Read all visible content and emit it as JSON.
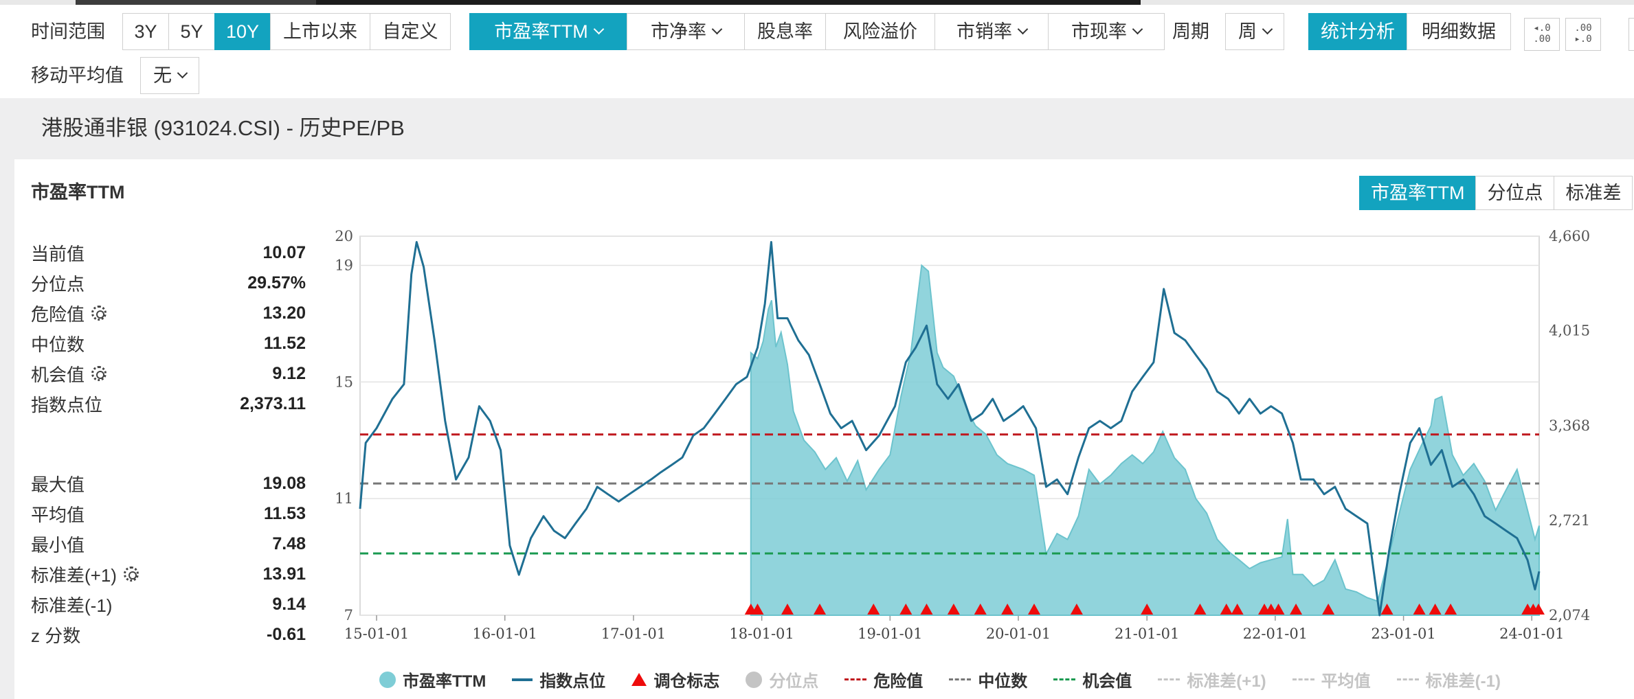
{
  "toolbar": {
    "time_range_label": "时间范围",
    "time_ranges": [
      "3Y",
      "5Y",
      "10Y",
      "上市以来",
      "自定义"
    ],
    "time_range_selected": "10Y",
    "metrics": [
      "市盈率TTM",
      "市净率",
      "股息率",
      "风险溢价",
      "市销率",
      "市现率"
    ],
    "metric_selected": "市盈率TTM",
    "period_label": "周期",
    "period_value": "周",
    "views": [
      "统计分析",
      "明细数据"
    ],
    "view_selected": "统计分析",
    "decimal_inc_icon": "increase-decimals-icon",
    "decimal_dec_icon": "decrease-decimals-icon",
    "ma_label": "移动平均值",
    "ma_value": "无"
  },
  "page_title": "港股通非银 (931024.CSI) - 历史PE/PB",
  "card": {
    "title": "市盈率TTM",
    "tabs": [
      "市盈率TTM",
      "分位点",
      "标准差"
    ],
    "tab_selected": "市盈率TTM"
  },
  "stats_top": [
    {
      "label": "当前值",
      "value": "10.07",
      "gear": false
    },
    {
      "label": "分位点",
      "value": "29.57%",
      "gear": false
    },
    {
      "label": "危险值",
      "value": "13.20",
      "gear": true
    },
    {
      "label": "中位数",
      "value": "11.52",
      "gear": false
    },
    {
      "label": "机会值",
      "value": "9.12",
      "gear": true
    },
    {
      "label": "指数点位",
      "value": "2,373.11",
      "gear": false
    }
  ],
  "stats_bottom": [
    {
      "label": "最大值",
      "value": "19.08",
      "gear": false
    },
    {
      "label": "平均值",
      "value": "11.53",
      "gear": false
    },
    {
      "label": "最小值",
      "value": "7.48",
      "gear": false
    },
    {
      "label": "标准差(+1)",
      "value": "13.91",
      "gear": true
    },
    {
      "label": "标准差(-1)",
      "value": "9.14",
      "gear": false
    },
    {
      "label": "z 分数",
      "value": "-0.61",
      "gear": false
    }
  ],
  "colors": {
    "accent": "#13a3bf",
    "pe_area": "#7ecdd6",
    "index_line": "#1f6f93",
    "danger": "#c0181e",
    "median": "#777777",
    "opportunity": "#1a9a50",
    "marker": "#ee0b0b"
  },
  "chart_data": {
    "type": "area",
    "x_ticks": [
      "15-01-01",
      "16-01-01",
      "17-01-01",
      "18-01-01",
      "19-01-01",
      "20-01-01",
      "21-01-01",
      "22-01-01",
      "23-01-01",
      "24-01-01"
    ],
    "y_left_ticks": [
      "20",
      "19",
      "15",
      "11",
      "7"
    ],
    "y_left_range": [
      7,
      20
    ],
    "y_right_ticks": [
      "4,660",
      "4,015",
      "3,368",
      "2,721",
      "2,074"
    ],
    "y_right_range": [
      2074,
      4660
    ],
    "x_range": [
      "2014-11-15",
      "2024-01-22"
    ],
    "grid": true,
    "legend_position": "bottom",
    "series": [
      {
        "name": "市盈率TTM",
        "axis": "left",
        "style": "area",
        "points": [
          [
            "2017-12-01",
            16.0
          ],
          [
            "2017-12-20",
            15.8
          ],
          [
            "2018-01-05",
            16.4
          ],
          [
            "2018-01-20",
            17.5
          ],
          [
            "2018-01-29",
            17.8
          ],
          [
            "2018-02-10",
            16.2
          ],
          [
            "2018-02-25",
            16.7
          ],
          [
            "2018-03-15",
            15.6
          ],
          [
            "2018-04-01",
            14.0
          ],
          [
            "2018-05-01",
            13.0
          ],
          [
            "2018-06-01",
            12.6
          ],
          [
            "2018-07-01",
            12.0
          ],
          [
            "2018-08-01",
            12.4
          ],
          [
            "2018-09-01",
            11.6
          ],
          [
            "2018-10-01",
            12.3
          ],
          [
            "2018-10-25",
            11.3
          ],
          [
            "2018-12-01",
            12.0
          ],
          [
            "2019-01-01",
            12.5
          ],
          [
            "2019-02-01",
            14.5
          ],
          [
            "2019-03-01",
            16.0
          ],
          [
            "2019-04-01",
            19.0
          ],
          [
            "2019-04-20",
            18.8
          ],
          [
            "2019-05-15",
            16.0
          ],
          [
            "2019-06-01",
            15.5
          ],
          [
            "2019-07-01",
            15.2
          ],
          [
            "2019-08-10",
            14.0
          ],
          [
            "2019-09-01",
            13.5
          ],
          [
            "2019-10-01",
            13.2
          ],
          [
            "2019-11-01",
            12.5
          ],
          [
            "2019-12-01",
            12.2
          ],
          [
            "2020-01-15",
            12.0
          ],
          [
            "2020-02-15",
            11.8
          ],
          [
            "2020-03-20",
            9.1
          ],
          [
            "2020-04-20",
            9.8
          ],
          [
            "2020-05-20",
            9.6
          ],
          [
            "2020-06-20",
            10.4
          ],
          [
            "2020-07-20",
            12.0
          ],
          [
            "2020-08-20",
            11.5
          ],
          [
            "2020-09-20",
            11.8
          ],
          [
            "2020-10-20",
            12.2
          ],
          [
            "2020-11-20",
            12.5
          ],
          [
            "2020-12-20",
            12.2
          ],
          [
            "2021-01-20",
            12.6
          ],
          [
            "2021-02-15",
            13.3
          ],
          [
            "2021-03-20",
            12.4
          ],
          [
            "2021-04-20",
            12.0
          ],
          [
            "2021-05-20",
            11.0
          ],
          [
            "2021-06-20",
            10.5
          ],
          [
            "2021-07-20",
            9.6
          ],
          [
            "2021-08-20",
            9.2
          ],
          [
            "2021-09-20",
            8.9
          ],
          [
            "2021-10-20",
            8.6
          ],
          [
            "2021-11-20",
            8.8
          ],
          [
            "2021-12-20",
            8.9
          ],
          [
            "2022-01-20",
            9.0
          ],
          [
            "2022-02-05",
            10.3
          ],
          [
            "2022-02-20",
            8.4
          ],
          [
            "2022-03-20",
            8.4
          ],
          [
            "2022-04-20",
            8.0
          ],
          [
            "2022-05-20",
            8.2
          ],
          [
            "2022-06-20",
            8.9
          ],
          [
            "2022-07-20",
            7.9
          ],
          [
            "2022-08-20",
            7.8
          ],
          [
            "2022-09-20",
            7.6
          ],
          [
            "2022-10-20",
            7.48
          ],
          [
            "2022-11-20",
            9.0
          ],
          [
            "2022-12-20",
            10.5
          ],
          [
            "2023-01-20",
            12.0
          ],
          [
            "2023-02-20",
            12.8
          ],
          [
            "2023-03-20",
            13.5
          ],
          [
            "2023-04-01",
            14.4
          ],
          [
            "2023-04-20",
            14.5
          ],
          [
            "2023-05-20",
            12.5
          ],
          [
            "2023-06-20",
            11.8
          ],
          [
            "2023-07-20",
            12.2
          ],
          [
            "2023-08-20",
            11.6
          ],
          [
            "2023-09-20",
            10.6
          ],
          [
            "2023-10-20",
            11.3
          ],
          [
            "2023-11-20",
            12.0
          ],
          [
            "2023-12-20",
            10.6
          ],
          [
            "2024-01-10",
            9.6
          ],
          [
            "2024-01-22",
            10.07
          ]
        ]
      },
      {
        "name": "指数点位",
        "axis": "right",
        "style": "line",
        "points": [
          [
            "2014-11-15",
            2800
          ],
          [
            "2014-12-01",
            3250
          ],
          [
            "2015-01-01",
            3350
          ],
          [
            "2015-02-15",
            3550
          ],
          [
            "2015-03-20",
            3650
          ],
          [
            "2015-04-10",
            4400
          ],
          [
            "2015-04-25",
            4620
          ],
          [
            "2015-05-15",
            4450
          ],
          [
            "2015-06-15",
            3950
          ],
          [
            "2015-07-15",
            3400
          ],
          [
            "2015-08-15",
            3000
          ],
          [
            "2015-09-20",
            3150
          ],
          [
            "2015-10-20",
            3500
          ],
          [
            "2015-11-20",
            3400
          ],
          [
            "2015-12-20",
            3200
          ],
          [
            "2016-01-15",
            2550
          ],
          [
            "2016-02-10",
            2350
          ],
          [
            "2016-03-15",
            2600
          ],
          [
            "2016-04-20",
            2750
          ],
          [
            "2016-05-20",
            2650
          ],
          [
            "2016-06-20",
            2600
          ],
          [
            "2016-07-20",
            2700
          ],
          [
            "2016-08-20",
            2800
          ],
          [
            "2016-09-20",
            2950
          ],
          [
            "2016-10-20",
            2900
          ],
          [
            "2016-11-20",
            2850
          ],
          [
            "2016-12-20",
            2900
          ],
          [
            "2017-01-20",
            2950
          ],
          [
            "2017-02-20",
            3000
          ],
          [
            "2017-03-20",
            3050
          ],
          [
            "2017-04-20",
            3100
          ],
          [
            "2017-05-20",
            3150
          ],
          [
            "2017-06-20",
            3300
          ],
          [
            "2017-07-20",
            3350
          ],
          [
            "2017-08-20",
            3450
          ],
          [
            "2017-09-20",
            3550
          ],
          [
            "2017-10-20",
            3650
          ],
          [
            "2017-11-20",
            3700
          ],
          [
            "2017-12-20",
            3900
          ],
          [
            "2018-01-10",
            4200
          ],
          [
            "2018-01-28",
            4620
          ],
          [
            "2018-02-15",
            4100
          ],
          [
            "2018-03-15",
            4100
          ],
          [
            "2018-04-15",
            3950
          ],
          [
            "2018-05-15",
            3850
          ],
          [
            "2018-06-15",
            3650
          ],
          [
            "2018-07-15",
            3450
          ],
          [
            "2018-08-15",
            3350
          ],
          [
            "2018-09-15",
            3400
          ],
          [
            "2018-10-25",
            3200
          ],
          [
            "2018-12-01",
            3300
          ],
          [
            "2019-01-15",
            3500
          ],
          [
            "2019-02-15",
            3800
          ],
          [
            "2019-03-15",
            3900
          ],
          [
            "2019-04-15",
            4050
          ],
          [
            "2019-05-15",
            3650
          ],
          [
            "2019-06-15",
            3550
          ],
          [
            "2019-07-15",
            3650
          ],
          [
            "2019-08-20",
            3400
          ],
          [
            "2019-09-20",
            3450
          ],
          [
            "2019-10-20",
            3550
          ],
          [
            "2019-11-20",
            3400
          ],
          [
            "2019-12-20",
            3450
          ],
          [
            "2020-01-15",
            3500
          ],
          [
            "2020-02-20",
            3350
          ],
          [
            "2020-03-20",
            2950
          ],
          [
            "2020-04-20",
            3000
          ],
          [
            "2020-05-20",
            2900
          ],
          [
            "2020-06-20",
            3150
          ],
          [
            "2020-07-20",
            3350
          ],
          [
            "2020-08-20",
            3400
          ],
          [
            "2020-09-20",
            3350
          ],
          [
            "2020-10-20",
            3400
          ],
          [
            "2020-11-20",
            3600
          ],
          [
            "2020-12-20",
            3700
          ],
          [
            "2021-01-20",
            3800
          ],
          [
            "2021-02-18",
            4300
          ],
          [
            "2021-03-20",
            4000
          ],
          [
            "2021-04-20",
            3950
          ],
          [
            "2021-05-20",
            3850
          ],
          [
            "2021-06-20",
            3750
          ],
          [
            "2021-07-20",
            3600
          ],
          [
            "2021-08-20",
            3550
          ],
          [
            "2021-09-20",
            3450
          ],
          [
            "2021-10-20",
            3550
          ],
          [
            "2021-11-20",
            3450
          ],
          [
            "2021-12-20",
            3500
          ],
          [
            "2022-01-20",
            3450
          ],
          [
            "2022-02-20",
            3250
          ],
          [
            "2022-03-15",
            3000
          ],
          [
            "2022-04-20",
            3000
          ],
          [
            "2022-05-20",
            2900
          ],
          [
            "2022-06-20",
            2950
          ],
          [
            "2022-07-20",
            2800
          ],
          [
            "2022-08-20",
            2750
          ],
          [
            "2022-09-20",
            2700
          ],
          [
            "2022-10-25",
            2074
          ],
          [
            "2022-11-20",
            2500
          ],
          [
            "2022-12-20",
            2900
          ],
          [
            "2023-01-20",
            3250
          ],
          [
            "2023-02-15",
            3350
          ],
          [
            "2023-03-20",
            3100
          ],
          [
            "2023-04-20",
            3200
          ],
          [
            "2023-05-20",
            2950
          ],
          [
            "2023-06-20",
            3000
          ],
          [
            "2023-07-20",
            2900
          ],
          [
            "2023-08-20",
            2750
          ],
          [
            "2023-09-20",
            2700
          ],
          [
            "2023-10-20",
            2650
          ],
          [
            "2023-11-20",
            2600
          ],
          [
            "2023-12-20",
            2450
          ],
          [
            "2024-01-10",
            2250
          ],
          [
            "2024-01-22",
            2373
          ]
        ]
      }
    ],
    "reference_lines": [
      {
        "name": "危险值",
        "value": 13.2,
        "color": "#c0181e"
      },
      {
        "name": "中位数",
        "value": 11.52,
        "color": "#777777"
      },
      {
        "name": "机会值",
        "value": 9.12,
        "color": "#1a9a50"
      }
    ],
    "rebalance_markers": [
      "2017-12-01",
      "2017-12-20",
      "2018-03-15",
      "2018-06-15",
      "2018-11-15",
      "2019-02-15",
      "2019-04-15",
      "2019-07-01",
      "2019-09-15",
      "2019-12-01",
      "2020-02-15",
      "2020-06-15",
      "2021-01-01",
      "2021-06-01",
      "2021-08-15",
      "2021-09-15",
      "2021-12-01",
      "2021-12-20",
      "2022-01-10",
      "2022-03-01",
      "2022-06-01",
      "2022-11-15",
      "2023-02-15",
      "2023-04-01",
      "2023-05-15",
      "2023-12-20",
      "2024-01-05",
      "2024-01-20"
    ],
    "legend": [
      {
        "name": "市盈率TTM",
        "kind": "dot",
        "color": "#7ecdd6",
        "active": true
      },
      {
        "name": "指数点位",
        "kind": "line",
        "color": "#1f6f93",
        "active": true
      },
      {
        "name": "调仓标志",
        "kind": "tri",
        "color": "#ee0b0b",
        "active": true
      },
      {
        "name": "分位点",
        "kind": "dot",
        "color": "#c4c4c4",
        "active": false
      },
      {
        "name": "危险值",
        "kind": "dash",
        "color": "#c0181e",
        "active": true
      },
      {
        "name": "中位数",
        "kind": "dash",
        "color": "#777777",
        "active": true
      },
      {
        "name": "机会值",
        "kind": "dash",
        "color": "#1a9a50",
        "active": true
      },
      {
        "name": "标准差(+1)",
        "kind": "dash",
        "color": "#c4c4c4",
        "active": false
      },
      {
        "name": "平均值",
        "kind": "dash",
        "color": "#c4c4c4",
        "active": false
      },
      {
        "name": "标准差(-1)",
        "kind": "dash",
        "color": "#c4c4c4",
        "active": false
      }
    ]
  }
}
